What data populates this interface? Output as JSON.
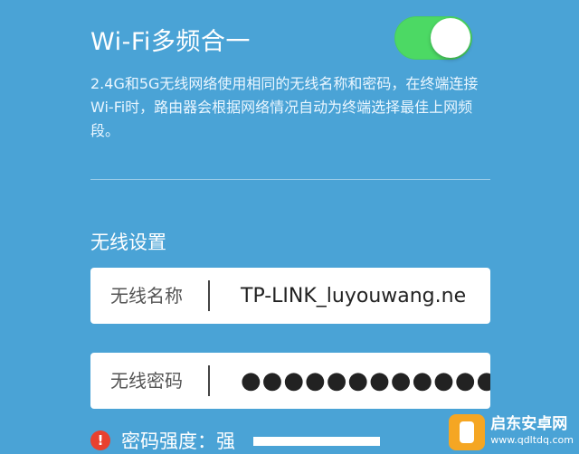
{
  "wifi_merge": {
    "title": "Wi-Fi多频合一",
    "enabled": true,
    "description": "2.4G和5G无线网络使用相同的无线名称和密码，在终端连接Wi-Fi时，路由器会根据网络情况自动为终端选择最佳上网频段。"
  },
  "wireless": {
    "section_title": "无线设置",
    "name_label": "无线名称",
    "name_value": "TP-LINK_luyouwang.ne",
    "password_label": "无线密码",
    "password_value": "●●●●●●●●●●●●",
    "strength_label": "密码强度：强",
    "strength_icon": "warning-icon"
  },
  "watermark": {
    "title": "启东安卓网",
    "url": "www.qdltdq.com"
  },
  "colors": {
    "background": "#4aa3d6",
    "toggle_on": "#4cd964",
    "warning": "#e8412f"
  }
}
